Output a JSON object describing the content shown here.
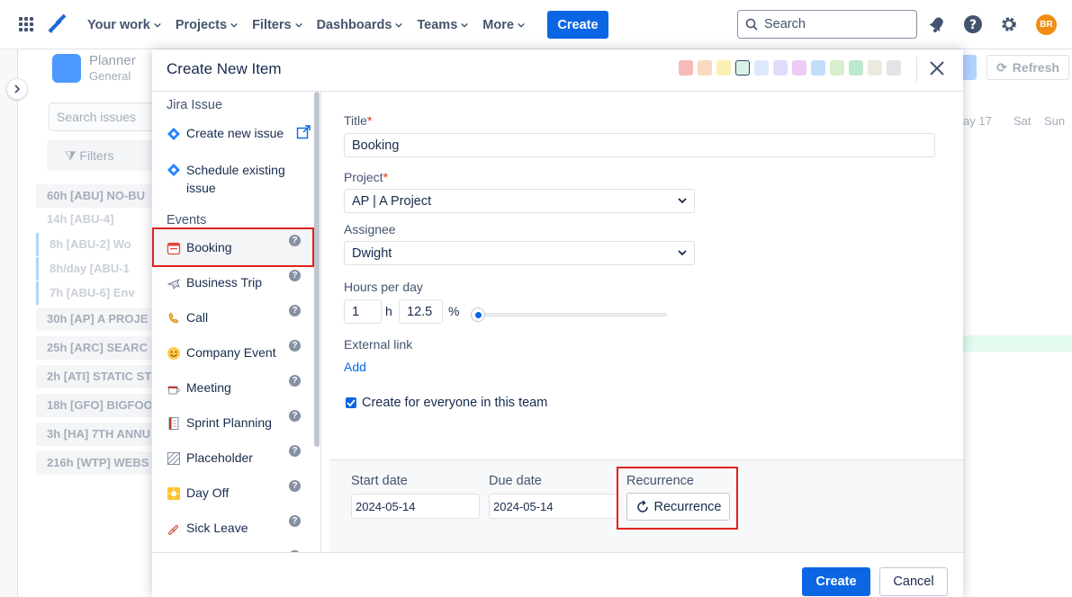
{
  "topnav": {
    "items": [
      {
        "label": "Your work"
      },
      {
        "label": "Projects"
      },
      {
        "label": "Filters"
      },
      {
        "label": "Dashboards"
      },
      {
        "label": "Teams"
      },
      {
        "label": "More"
      }
    ],
    "create_label": "Create",
    "search_placeholder": "Search",
    "avatar_initials": "BR",
    "accent_color": "#0c66e4"
  },
  "background": {
    "planner_title": "Planner",
    "planner_subtitle": "General",
    "search_placeholder": "Search issues",
    "filters_label": "Filters",
    "refresh_label": "Refresh",
    "day_headers": [
      "ay 17",
      "Sat",
      "Sun"
    ],
    "rows": [
      "60h [ABU] NO-BU",
      "14h [ABU-4]",
      "8h [ABU-2] Wo",
      "8h/day [ABU-1",
      "7h [ABU-6] Env",
      "30h [AP] A PROJE",
      "25h [ARC] SEARC",
      "2h [ATI] STATIC ST",
      "18h [GFO] BIGFOO",
      "3h [HA] 7TH ANNU",
      "216h [WTP] WEBS"
    ]
  },
  "modal": {
    "title": "Create New Item",
    "swatch_colors": [
      "#f8b9b9",
      "#f9d9c1",
      "#fbf0b1",
      "#d8f2e6",
      "#dde9fb",
      "#e2dcfb",
      "#eecbf6",
      "#c3dcf9",
      "#d8f0d0",
      "#bde8d2",
      "#ece9df",
      "#e3e4e8"
    ],
    "sidebar": {
      "jira_heading": "Jira Issue",
      "jira_items": [
        {
          "label": "Create new issue"
        },
        {
          "label": "Schedule existing issue"
        }
      ],
      "events_heading": "Events",
      "event_items": [
        {
          "label": "Booking"
        },
        {
          "label": "Business Trip"
        },
        {
          "label": "Call"
        },
        {
          "label": "Company Event"
        },
        {
          "label": "Meeting"
        },
        {
          "label": "Sprint Planning"
        },
        {
          "label": "Placeholder"
        },
        {
          "label": "Day Off"
        },
        {
          "label": "Sick Leave"
        }
      ],
      "help_glyph": "?"
    },
    "form": {
      "title_label": "Title",
      "title_value": "Booking",
      "project_label": "Project",
      "project_value": "AP | A Project",
      "assignee_label": "Assignee",
      "assignee_value": "Dwight",
      "hours_label": "Hours per day",
      "hours_value": "1",
      "hours_unit": "h",
      "percent_value": "12.5",
      "percent_unit": "%",
      "slider_fraction": 0.04,
      "external_link_label": "External link",
      "add_link_label": "Add",
      "everyone_label": "Create for everyone in this team",
      "everyone_checked": true,
      "required_marker": "*"
    },
    "dates": {
      "start_label": "Start date",
      "start_value": "2024-05-14",
      "due_label": "Due date",
      "due_value": "2024-05-14",
      "recurrence_label": "Recurrence",
      "recurrence_button": "Recurrence"
    },
    "footer": {
      "create_label": "Create",
      "cancel_label": "Cancel"
    }
  }
}
